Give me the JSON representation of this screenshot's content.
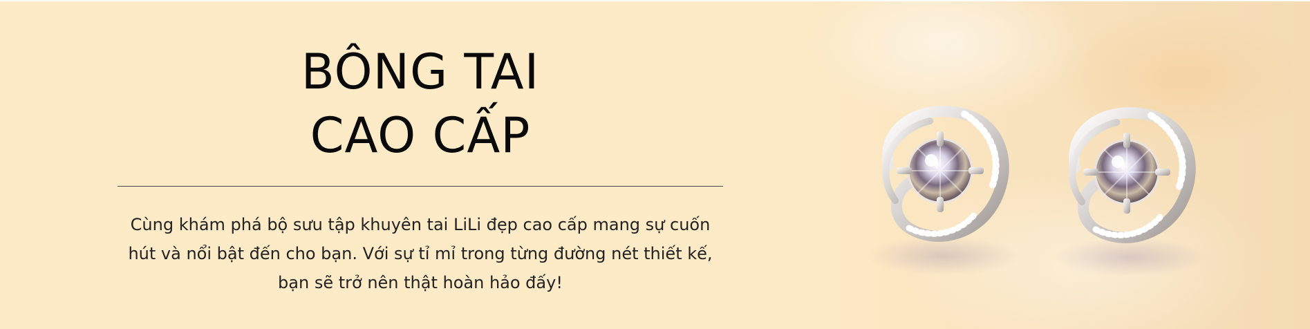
{
  "banner": {
    "title_line1": "BÔNG TAI",
    "title_line2": "CAO CẤP",
    "description": "Cùng khám phá bộ sưu tập khuyên tai LiLi đẹp cao cấp mang sự cuốn hút và nổi bật đến cho bạn. Với sự tỉ mỉ trong từng đường nét thiết kế, bạn sẽ trở nên thật hoàn hảo đấy!",
    "background_color": "#fdeac6",
    "image": "earrings-product-photo"
  }
}
